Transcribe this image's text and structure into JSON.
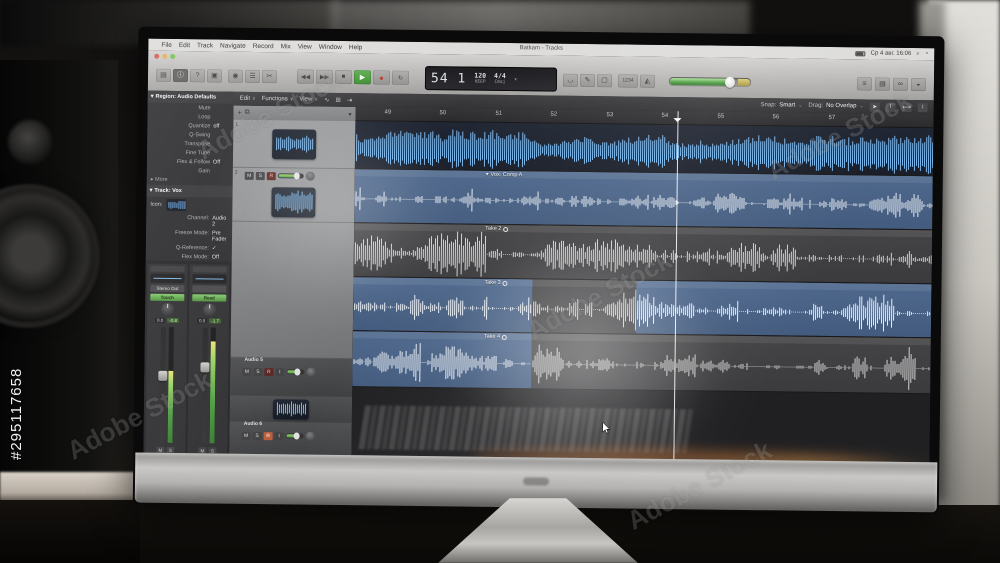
{
  "watermark": {
    "brand": "Adobe Stock",
    "photo_id": "#295117658"
  },
  "menubar": {
    "apple": "",
    "menus": [
      "File",
      "Edit",
      "Track",
      "Navigate",
      "Record",
      "Mix",
      "View",
      "Window",
      "Help"
    ],
    "clock": "Ср 4 авг. 16:06"
  },
  "window_title": "Batkam - Tracks",
  "control_bar": {
    "glyphs": {
      "library": "▤",
      "inspector": "ⓘ",
      "quick_help": "?",
      "toolbar": "▣",
      "smart_controls": "◉",
      "mixer": "☰",
      "editors": "✂",
      "rewind": "◀◀",
      "forward": "▶▶",
      "stop": "■",
      "play": "▶",
      "record": "●",
      "cycle": "↻",
      "tuner": "◡",
      "pencil": "✎",
      "solo": "▢",
      "count_in": "1234",
      "metronome": "◭",
      "list_editors": "≡",
      "note_pads": "▤",
      "apple_loops": "∞",
      "browsers": "◒"
    }
  },
  "lcd": {
    "bar": "54",
    "beat": "1",
    "tempo": "120",
    "tempo_mode": "KEEP",
    "time_signature": "4/4",
    "key": "Cmaj"
  },
  "tracks_toolbar": {
    "menus": [
      "Edit",
      "Functions",
      "View"
    ],
    "snap_label": "Snap:",
    "snap_value": "Smart",
    "drag_label": "Drag:",
    "drag_value": "No Overlap"
  },
  "ruler_bars": [
    "49",
    "50",
    "51",
    "52",
    "53",
    "54",
    "55",
    "56",
    "57"
  ],
  "inspector": {
    "region_section": "Region: Audio Defaults",
    "params": [
      [
        "Mute",
        ""
      ],
      [
        "Loop",
        ""
      ],
      [
        "Quantize",
        "off"
      ],
      [
        "Q-Swing",
        ""
      ],
      [
        "Transpose",
        ""
      ],
      [
        "Fine Tune",
        ""
      ],
      [
        "Flex & Follow",
        "Off"
      ],
      [
        "Gain",
        ""
      ]
    ],
    "more": "More",
    "track_section": "Track: Vox",
    "track_params": [
      [
        "Icon:",
        ""
      ],
      [
        "Channel:",
        "Audio 2"
      ],
      [
        "Freeze Mode:",
        "Pre Fader"
      ],
      [
        "Q-Reference:",
        "✓"
      ],
      [
        "Flex Mode:",
        "Off"
      ]
    ],
    "strips": {
      "output": "Stereo Out",
      "left_automation": "Touch",
      "right_automation": "Read",
      "left_pan": "0.0",
      "left_vol": "-0.8",
      "right_pan": "0.0",
      "right_vol": "-1.7",
      "mute": "M",
      "solo": "S"
    }
  },
  "track_headers": {
    "add": "+",
    "duplicate": "⧉",
    "settings": "▾",
    "track1_num": "1",
    "track2_num": "2",
    "audio5": "Audio 5",
    "audio6": "Audio 6",
    "buttons": {
      "mute": "M",
      "solo": "S",
      "record": "R",
      "input": "I"
    }
  },
  "arrange": {
    "comp_label": "Vox: Comp A",
    "take2": "Take 2",
    "take3": "Take 3",
    "take4": "Take 4"
  },
  "colors": {
    "accent_blue_region": "#45638f",
    "waveform_blue": "#6db3f2",
    "gray_region": "#3f3f41",
    "play_green": "#3f9c33",
    "record_red": "#c33a32"
  }
}
